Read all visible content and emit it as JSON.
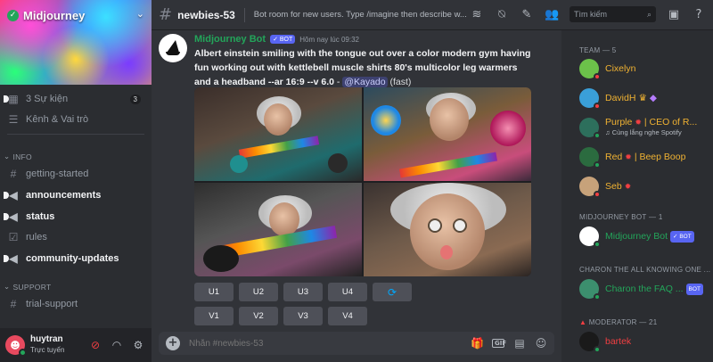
{
  "server": {
    "name": "Midjourney"
  },
  "sidebar": {
    "events": {
      "label": "3 Sự kiện",
      "count": "3"
    },
    "channels_roles": "Kênh & Vai trò",
    "info_category": "INFO",
    "info_channels": [
      {
        "label": "getting-started",
        "bold": false
      },
      {
        "label": "announcements",
        "bold": true
      },
      {
        "label": "status",
        "bold": true
      },
      {
        "label": "rules",
        "bold": false
      },
      {
        "label": "community-updates",
        "bold": true
      }
    ],
    "support_category": "SUPPORT",
    "support_channels": [
      {
        "label": "trial-support"
      }
    ]
  },
  "user": {
    "name": "huytran",
    "status": "Trực tuyến"
  },
  "header": {
    "channel": "newbies-53",
    "topic": "Bot room for new users. Type /imagine then describe w...",
    "search_placeholder": "Tìm kiếm"
  },
  "message": {
    "author": "Midjourney Bot",
    "bot_tag": "BOT",
    "timestamp": "Hôm nay lúc 09:32",
    "prompt": "Albert einstein smiling with the tongue out over a color modern gym having fun working out with kettlebell muscle shirts 80's multicolor leg warmers and a headband --ar 16:9 --v 6.0",
    "separator": " - ",
    "mention": "@Kayado",
    "mode": "(fast)"
  },
  "buttons": {
    "upscale": [
      "U1",
      "U2",
      "U3",
      "U4"
    ],
    "variation": [
      "V1",
      "V2",
      "V3",
      "V4"
    ],
    "reroll_icon": "refresh-icon"
  },
  "composer": {
    "placeholder": "Nhắn #newbies-53",
    "gif_label": "GIF"
  },
  "members": {
    "team_header": "TEAM — 5",
    "team": [
      {
        "name": "Cixelyn",
        "color": "#f0b232",
        "sub": ""
      },
      {
        "name": "DavidH",
        "color": "#f0b232",
        "sub": ""
      },
      {
        "name": "Purple",
        "role": "| CEO of R...",
        "color": "#f0b232",
        "sub": "Cùng lắng nghe Spotify"
      },
      {
        "name": "Red",
        "role": "| Beep Boop",
        "color": "#f0b232",
        "sub": ""
      },
      {
        "name": "Seb",
        "color": "#f0b232",
        "sub": ""
      }
    ],
    "bot_header": "MIDJOURNEY BOT — 1",
    "bot_member": {
      "name": "Midjourney Bot",
      "tag": "BOT",
      "color": "#23a55a"
    },
    "charon_header": "CHARON THE ALL KNOWING ONE ...",
    "charon_member": {
      "name": "Charon the FAQ ...",
      "tag": "BOT",
      "color": "#23a55a"
    },
    "mod_header": "MODERATOR — 21",
    "mod_member": {
      "name": "bartek",
      "color": "#f23f42"
    }
  },
  "colors": {
    "accent": "#5865f2",
    "online": "#23a55a",
    "dnd": "#f23f42",
    "idle": "#f0b232"
  }
}
